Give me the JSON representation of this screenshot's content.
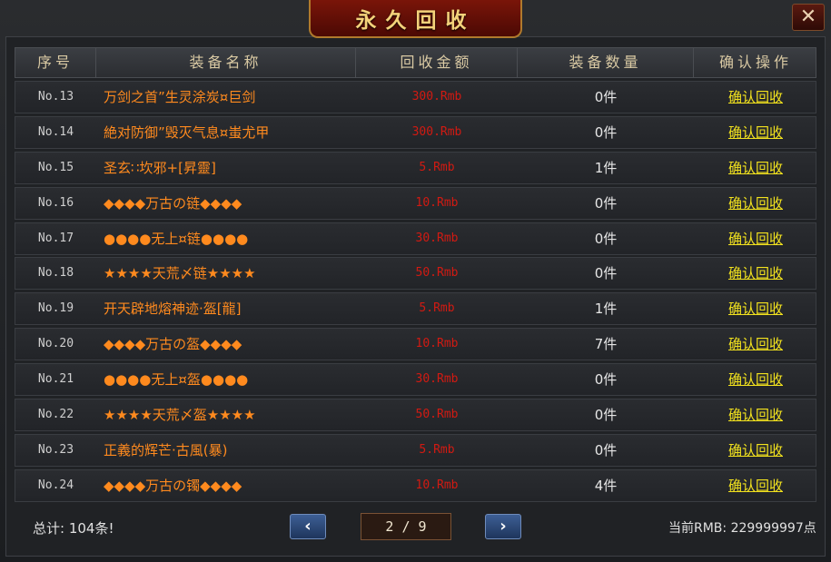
{
  "window": {
    "title": "永久回收",
    "close_glyph": "✕"
  },
  "table": {
    "headers": [
      "序号",
      "装备名称",
      "回收金额",
      "装备数量",
      "确认操作"
    ],
    "rows": [
      {
        "no": "No.13",
        "name": "万剑之首”生灵涂炭¤巨剑",
        "amount": "300.Rmb",
        "qty": "0件",
        "action": "确认回收"
      },
      {
        "no": "No.14",
        "name": "絶对防御”毁灭气息¤蚩尤甲",
        "amount": "300.Rmb",
        "qty": "0件",
        "action": "确认回收"
      },
      {
        "no": "No.15",
        "name": "圣玄∷坎邪+[昇靈]",
        "amount": "5.Rmb",
        "qty": "1件",
        "action": "确认回收"
      },
      {
        "no": "No.16",
        "name": "◆◆◆◆万古の链◆◆◆◆",
        "amount": "10.Rmb",
        "qty": "0件",
        "action": "确认回收"
      },
      {
        "no": "No.17",
        "name": "●●●●无上¤链●●●●",
        "amount": "30.Rmb",
        "qty": "0件",
        "action": "确认回收"
      },
      {
        "no": "No.18",
        "name": "★★★★天荒〆链★★★★",
        "amount": "50.Rmb",
        "qty": "0件",
        "action": "确认回收"
      },
      {
        "no": "No.19",
        "name": "开天辟地熔神迹·盔[龍]",
        "amount": "5.Rmb",
        "qty": "1件",
        "action": "确认回收"
      },
      {
        "no": "No.20",
        "name": "◆◆◆◆万古の盔◆◆◆◆",
        "amount": "10.Rmb",
        "qty": "7件",
        "action": "确认回收"
      },
      {
        "no": "No.21",
        "name": "●●●●无上¤盔●●●●",
        "amount": "30.Rmb",
        "qty": "0件",
        "action": "确认回收"
      },
      {
        "no": "No.22",
        "name": "★★★★天荒〆盔★★★★",
        "amount": "50.Rmb",
        "qty": "0件",
        "action": "确认回收"
      },
      {
        "no": "No.23",
        "name": "正義的辉芒·古風(暴)",
        "amount": "5.Rmb",
        "qty": "0件",
        "action": "确认回收"
      },
      {
        "no": "No.24",
        "name": "◆◆◆◆万古の镯◆◆◆◆",
        "amount": "10.Rmb",
        "qty": "4件",
        "action": "确认回收"
      }
    ]
  },
  "footer": {
    "total": "总计:  104条!",
    "prev_glyph": "‹",
    "next_glyph": "›",
    "page_display": "2 / 9",
    "rmb": "当前RMB: 229999997点"
  },
  "colors": {
    "item_name": "#ff8a1e",
    "amount": "#d21a12",
    "action_link": "#f2e21e",
    "header_text": "#d9c9a3"
  }
}
